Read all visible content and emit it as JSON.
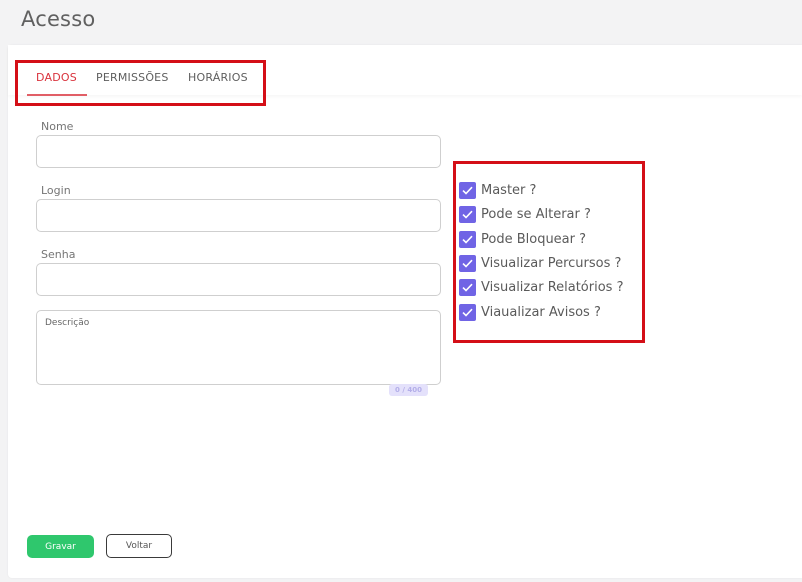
{
  "page": {
    "title": "Acesso"
  },
  "tabs": [
    {
      "label": "DADOS",
      "active": true
    },
    {
      "label": "PERMISSÕES",
      "active": false
    },
    {
      "label": "HORÁRIOS",
      "active": false
    }
  ],
  "form": {
    "nome": {
      "label": "Nome",
      "value": ""
    },
    "login": {
      "label": "Login",
      "value": ""
    },
    "senha": {
      "label": "Senha",
      "value": ""
    },
    "descricao": {
      "label": "Descrição",
      "value": "",
      "counter": "0 / 400"
    }
  },
  "permissions": [
    {
      "label": "Master ?",
      "checked": true
    },
    {
      "label": "Pode se Alterar ?",
      "checked": true
    },
    {
      "label": "Pode Bloquear ?",
      "checked": true
    },
    {
      "label": "Visualizar Percursos ?",
      "checked": true
    },
    {
      "label": "Visualizar Relatórios ?",
      "checked": true
    },
    {
      "label": "Viaualizar Avisos ?",
      "checked": true
    }
  ],
  "buttons": {
    "save": "Gravar",
    "back": "Voltar"
  },
  "colors": {
    "active_tab": "#d9323c",
    "checkbox": "#7064e5",
    "save_button": "#2fc76d",
    "highlight_box": "#d40f17"
  },
  "icons": {
    "checkbox_mark": "check-icon"
  }
}
